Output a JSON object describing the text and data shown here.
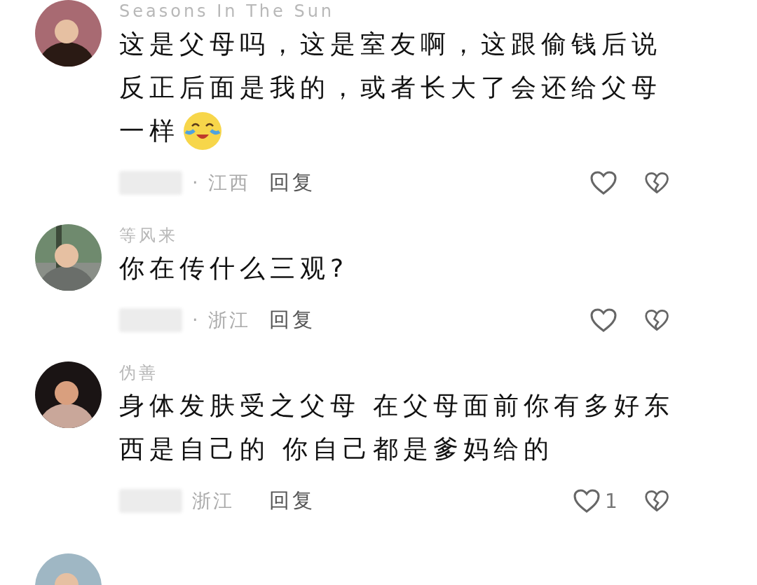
{
  "comments": [
    {
      "username": "Seasons In The Sun",
      "avatar": {
        "kind": "picture"
      },
      "lines": [
        "这是父母吗，这是室友啊，这跟偷钱后说",
        "反正后面是我的，或者长大了会还给父母",
        "一样"
      ],
      "emoji": true,
      "location": "· 江西",
      "reply": "回复"
    },
    {
      "username": "等风来",
      "avatar": {
        "kind": "picture"
      },
      "lines": [
        "你在传什么三观?"
      ],
      "emoji": false,
      "location": "· 浙江",
      "reply": "回复"
    },
    {
      "username": "伪善",
      "avatar": {
        "kind": "picture"
      },
      "lines": [
        "身体发肤受之父母 在父母面前你有多好东",
        "西是自己的 你自己都是爹妈给的"
      ],
      "emoji": false,
      "location": "浙江",
      "reply": "回复",
      "likes": "1"
    }
  ],
  "next_comment": {
    "avatar": {
      "kind": "picture"
    }
  }
}
